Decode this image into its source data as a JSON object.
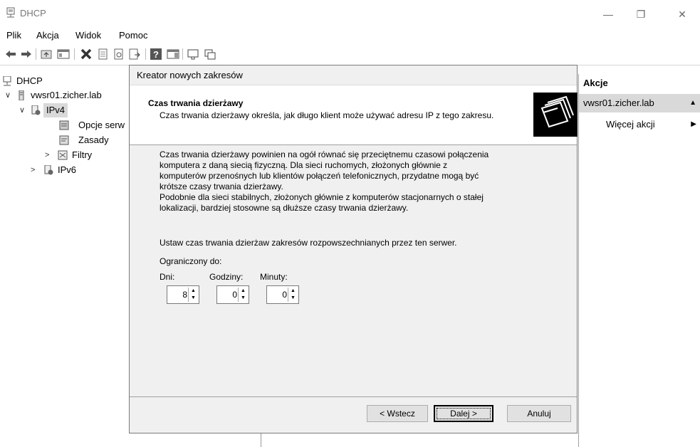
{
  "window": {
    "title": "DHCP",
    "min_glyph": "—",
    "max_glyph": "❐",
    "close_glyph": "✕"
  },
  "menu": [
    "Plik",
    "Akcja",
    "Widok",
    "Pomoc"
  ],
  "tree": {
    "root": "DHCP",
    "server": "vwsr01.zicher.lab",
    "ipv4": "IPv4",
    "scope_options": "Opcje serw",
    "policies": "Zasady",
    "filters": "Filtry",
    "ipv6": "IPv6"
  },
  "actions": {
    "header": "Akcje",
    "server": "vwsr01.zicher.lab",
    "more": "Więcej akcji"
  },
  "wizard": {
    "title": "Kreator nowych zakresów",
    "header_title": "Czas trwania dzierżawy",
    "header_desc": "Czas trwania dzierżawy określa, jak długo klient może używać adresu IP z tego zakresu.",
    "para1": [
      "Czas trwania dzierżawy powinien na ogół równać się przeciętnemu czasowi połączenia",
      "komputera z daną siecią fizyczną. Dla sieci ruchomych, złożonych głównie z",
      "komputerów przenośnych lub klientów połączeń telefonicznych, przydatne mogą być",
      "krótsze czasy trwania dzierżawy.",
      "Podobnie dla sieci stabilnych, złożonych głównie z komputerów stacjonarnych o stałej",
      "lokalizacji, bardziej stosowne są dłuższe czasy trwania dzierżawy."
    ],
    "para2": "Ustaw czas trwania dzierżaw zakresów rozpowszechnianych przez ten serwer.",
    "limited_to": "Ograniczony do:",
    "fields": {
      "days": {
        "label": "Dni:",
        "value": "8"
      },
      "hours": {
        "label": "Godziny:",
        "value": "0"
      },
      "minutes": {
        "label": "Minuty:",
        "value": "0"
      }
    },
    "buttons": {
      "back": "< Wstecz",
      "next": "Dalej >",
      "cancel": "Anuluj"
    }
  }
}
